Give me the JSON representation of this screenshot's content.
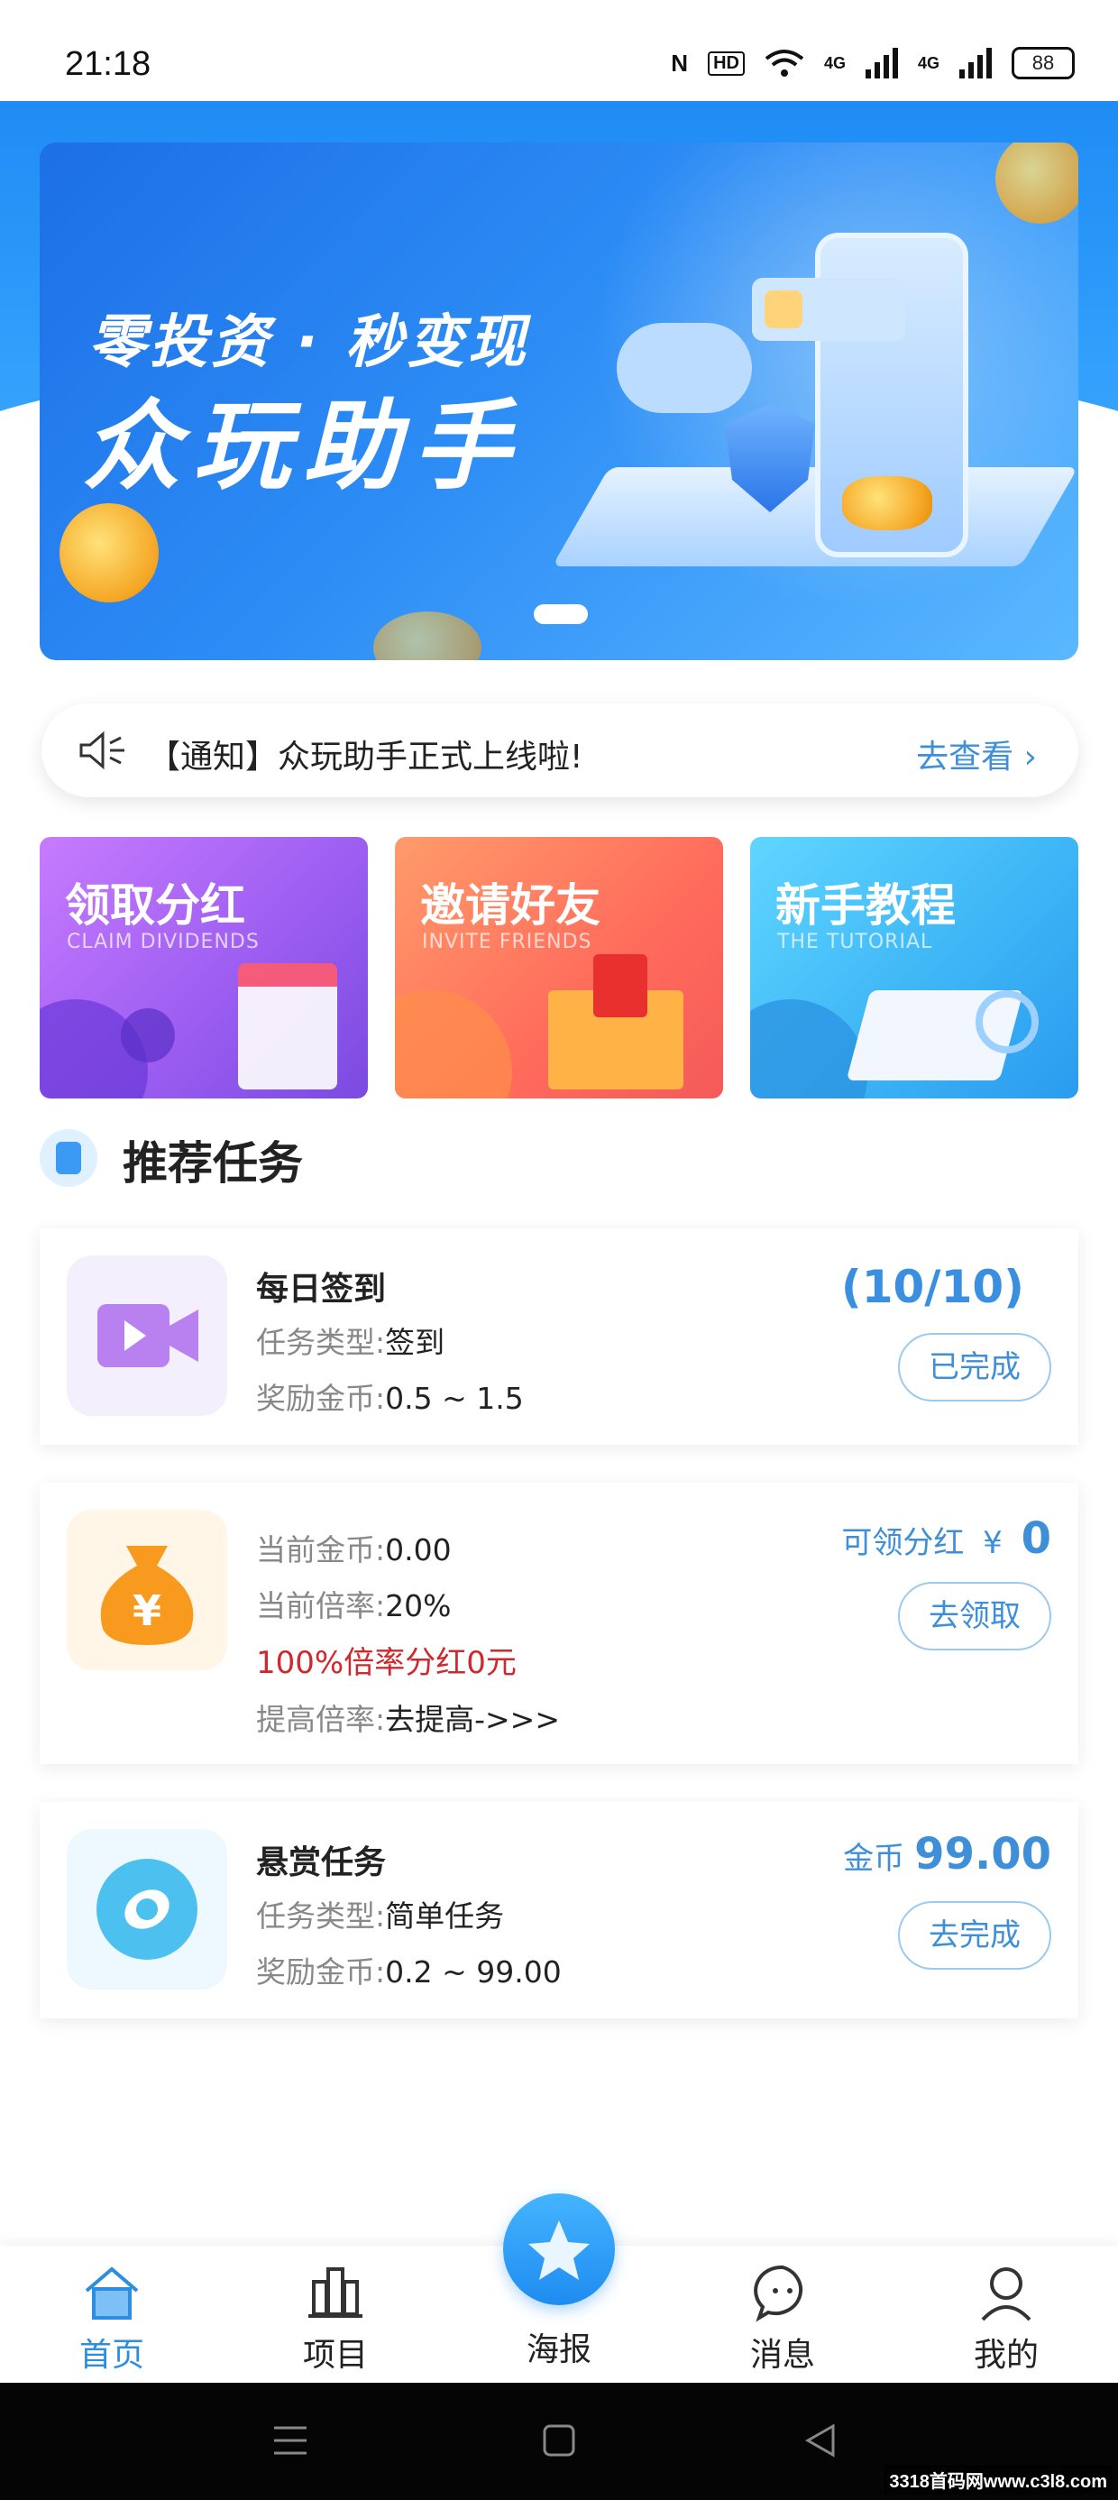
{
  "status": {
    "time": "21:18",
    "nfc": "N",
    "hd": "HD",
    "net1": "4G",
    "net2": "4G",
    "battery": "88"
  },
  "banner": {
    "subtitle": "零投资 · 秒变现",
    "title": "众玩助手"
  },
  "notice": {
    "text": "【通知】众玩助手正式上线啦!",
    "action": "去查看"
  },
  "features": [
    {
      "title": "领取分红",
      "subtitle": "CLAIM DIVIDENDS"
    },
    {
      "title": "邀请好友",
      "subtitle": "INVITE FRIENDS"
    },
    {
      "title": "新手教程",
      "subtitle": "THE TUTORIAL"
    }
  ],
  "section_title": "推荐任务",
  "tasks": {
    "daily": {
      "name": "每日签到",
      "type_label": "任务类型:",
      "type_value": "签到",
      "reward_label": "奖励金币:",
      "reward_value": "0.5 ~ 1.5",
      "progress": "(10/10)",
      "button": "已完成"
    },
    "dividend": {
      "coins_label": "当前金币:",
      "coins_value": "0.00",
      "rate_label": "当前倍率:",
      "rate_value": "20%",
      "note": "100%倍率分红0元",
      "boost_label": "提高倍率:",
      "boost_value": "去提高->>>",
      "claimable_label": "可领分红",
      "currency": "¥",
      "claimable_value": "0",
      "button": "去领取"
    },
    "bounty": {
      "name": "悬赏任务",
      "type_label": "任务类型:",
      "type_value": "简单任务",
      "reward_label": "奖励金币:",
      "reward_value": "0.2 ~ 99.00",
      "coin_label": "金币",
      "coin_value": "99.00",
      "button": "去完成"
    }
  },
  "nav": {
    "home": "首页",
    "project": "项目",
    "poster": "海报",
    "message": "消息",
    "mine": "我的"
  },
  "watermark": "3318首码网www.c3l8.com",
  "colors": {
    "primary": "#2d8ee0",
    "alert": "#d0282c"
  }
}
